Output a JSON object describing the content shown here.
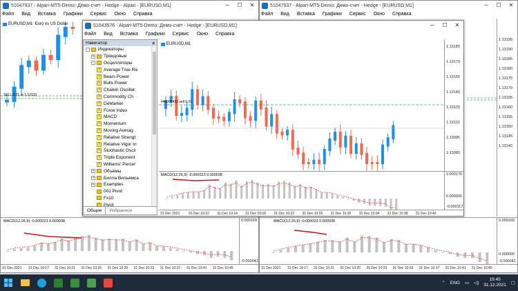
{
  "win1": {
    "title": "51047937 - Alpari-MT5-Demo: Демо-счет - Hedge - Alpari - [EURUSD,M1]",
    "menu": [
      "Файл",
      "Вид",
      "Вставка",
      "Графики",
      "Сервис",
      "Окно",
      "Справка"
    ],
    "symbol": "EURUSD,M1:  Euro vs US Dollar",
    "line_label": "SELL 0.01 at 1.13133",
    "indicator": "MACD(12,26,9) -0.000023 0.000038",
    "ind_max": "0.000169",
    "ind_min": "-0.000041",
    "times": [
      "31 Dec 2021",
      "31 Dec 10:17",
      "31 Dec 10:21",
      "31 Dec 10:25",
      "31 Dec 10:29",
      "31 Dec 10:23",
      "31 Dec 10:37",
      "31 Dec 10:41",
      "31 Dec 10:45"
    ]
  },
  "win2": {
    "title": "51047937 - Alpari-MT5-Demo: Демо-счет - Hedge - [EURUSD,M1]",
    "menu": [
      "Файл",
      "Вид",
      "Вставка",
      "Графики",
      "Сервис",
      "Окно",
      "Справка"
    ],
    "prices": [
      "1.13195",
      "1.13190",
      "1.13185",
      "1.13180",
      "1.13175",
      "1.13170",
      "1.13165",
      "1.13160",
      "1.13155",
      "1.13150",
      "1.13145",
      "1.13140"
    ],
    "indicator": "MACD(12,26,9) -0.000023 0.000038",
    "ind_max": "0.000169",
    "ind_zero": "0.000000",
    "ind_min": "-0.000041",
    "times": [
      "31 Dec 2021",
      "31 Dec 10:17",
      "31 Dec 10:21",
      "31 Dec 10:25",
      "31 Dec 10:29",
      "31 Dec 10:33",
      "31 Dec 10:37",
      "31 Dec 10:41",
      "31 Dec 10:45"
    ]
  },
  "win3": {
    "title": "51043576 - Alpari-MT5-Demo: Демо-счет - Hedge - [EURUSD,M1]",
    "menu": [
      "Файл",
      "Вид",
      "Вставка",
      "Графики",
      "Сервис",
      "Окно",
      "Справка"
    ],
    "symbol": "EURUSD,M1",
    "line_label": "#40000432 sell 0.01",
    "prices": [
      "1.13185",
      "1.13170",
      "1.13155",
      "1.13140",
      "1.13125",
      "1.13110",
      "1.13095",
      "1.13080"
    ],
    "indicator": "MACD(12,26,9) -0.000023 0.000038",
    "ind_max": "0.000176",
    "ind_zero": "0.000000",
    "ind_min": "-0.000117",
    "times": [
      "31 Dec 2021",
      "31 Dec 10:10",
      "31 Dec 10:14",
      "31 Dec 10:18",
      "31 Dec 10:22",
      "31 Dec 10:26",
      "31 Dec 10:30",
      "31 Dec 10:34",
      "31 Dec 10:38",
      "31 Dec 10:42"
    ]
  },
  "navigator": {
    "title": "Навигатор",
    "tabs": [
      "Общие",
      "Избранное"
    ],
    "items": [
      {
        "level": 0,
        "type": "folder",
        "label": "Индикаторы",
        "exp": "-"
      },
      {
        "level": 1,
        "type": "folder",
        "label": "Трендовые",
        "exp": "+"
      },
      {
        "level": 1,
        "type": "folder",
        "label": "Осцилляторы",
        "exp": "-"
      },
      {
        "level": 2,
        "type": "ind",
        "label": "Average True Ra"
      },
      {
        "level": 2,
        "type": "ind",
        "label": "Bears Power"
      },
      {
        "level": 2,
        "type": "ind",
        "label": "Bulls Power"
      },
      {
        "level": 2,
        "type": "ind",
        "label": "Chaikin Oscillat"
      },
      {
        "level": 2,
        "type": "ind",
        "label": "Commodity Ch"
      },
      {
        "level": 2,
        "type": "ind",
        "label": "DeMarker"
      },
      {
        "level": 2,
        "type": "ind",
        "label": "Force Index"
      },
      {
        "level": 2,
        "type": "ind",
        "label": "MACD"
      },
      {
        "level": 2,
        "type": "ind",
        "label": "Momentum"
      },
      {
        "level": 2,
        "type": "ind",
        "label": "Moving Averag"
      },
      {
        "level": 2,
        "type": "ind",
        "label": "Relative Strengt"
      },
      {
        "level": 2,
        "type": "ind",
        "label": "Relative Vigor In"
      },
      {
        "level": 2,
        "type": "ind",
        "label": "Stochastic Oscil"
      },
      {
        "level": 2,
        "type": "ind",
        "label": "Triple Exponent"
      },
      {
        "level": 2,
        "type": "ind",
        "label": "Williams' Percer"
      },
      {
        "level": 1,
        "type": "folder",
        "label": "Объемы",
        "exp": "+"
      },
      {
        "level": 1,
        "type": "folder",
        "label": "Билла Вильямса",
        "exp": "+"
      },
      {
        "level": 1,
        "type": "folder",
        "label": "Examples",
        "exp": "+"
      },
      {
        "level": 1,
        "type": "folder",
        "label": "001 Pivot",
        "exp": ""
      },
      {
        "level": 1,
        "type": "folder",
        "label": "Fx10",
        "exp": ""
      },
      {
        "level": 1,
        "type": "folder",
        "label": "Pivot",
        "exp": ""
      }
    ]
  },
  "taskbar": {
    "lang": "ENG",
    "time": "19:45",
    "date": "31.12.2021"
  },
  "colors": {
    "bull": "#1f8fe8",
    "bear": "#f4684e",
    "hist": "#c2c2c2",
    "signal": "#e23b3b",
    "pos_line": "#3aa24c",
    "accent": "#cc1111"
  }
}
